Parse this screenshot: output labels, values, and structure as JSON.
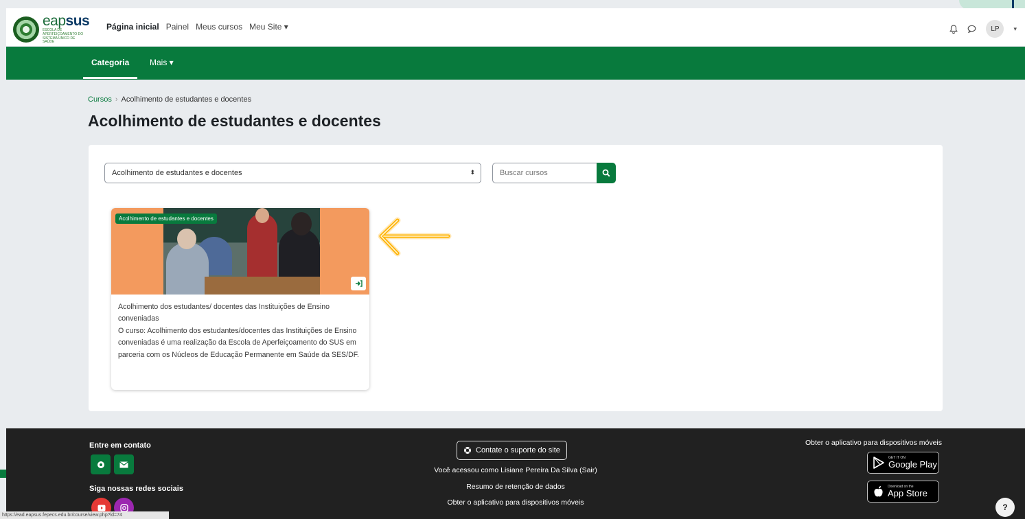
{
  "brand": {
    "name_light": "eap",
    "name_bold": "sus",
    "tagline": "ESCOLA DE APERFEIÇOAMENTO DO SISTEMA ÚNICO DE SAÚDE"
  },
  "nav": {
    "items": [
      {
        "label": "Página inicial"
      },
      {
        "label": "Painel"
      },
      {
        "label": "Meus cursos"
      },
      {
        "label": "Meu Site ▾"
      }
    ]
  },
  "user": {
    "initials": "LP"
  },
  "secondary_nav": {
    "category": "Categoria",
    "more": "Mais ▾"
  },
  "breadcrumb": {
    "root": "Cursos",
    "separator": "›",
    "current": "Acolhimento de estudantes e docentes"
  },
  "page_title": "Acolhimento de estudantes e docentes",
  "filters": {
    "category_value": "Acolhimento de estudantes e docentes",
    "search_placeholder": "Buscar cursos"
  },
  "course": {
    "badge": "Acolhimento de estudantes e docentes",
    "title": "Acolhimento dos estudantes/ docentes das Instituições de Ensino conveniadas",
    "summary": "O curso: Acolhimento dos estudantes/docentes das Instituições de Ensino conveniadas é uma realização da Escola de Aperfeiçoamento do SUS em parceria com os Núcleos de Educação Permanente em Saúde da SES/DF."
  },
  "footer": {
    "contact_title": "Entre em contato",
    "social_title": "Siga nossas redes sociais",
    "support_label": "Contate o suporte do site",
    "logged_in_text": "Você acessou como Lisiane Pereira Da Silva (Sair)",
    "data_retention": "Resumo de retenção de dados",
    "mobile_app_link": "Obter o aplicativo para dispositivos móveis",
    "mobile_app_title": "Obter o aplicativo para dispositivos móveis",
    "google_play_small": "GET IT ON",
    "google_play_big": "Google Play",
    "app_store_small": "Download on the",
    "app_store_big": "App Store",
    "help": "?"
  },
  "status_url": "https://ead.eapsus.fepecs.edu.br/course/view.php?id=74",
  "colors": {
    "primary": "#087a3d",
    "footer_bg": "#212121",
    "page_bg": "#e9ecef",
    "card_image_bg": "#f39a5e",
    "annotation_arrow": "#ffb300"
  },
  "icons": {
    "bell": "bell-icon",
    "chat": "chat-icon",
    "search": "search-icon",
    "enter": "enter-course-icon",
    "globe": "globe-icon",
    "mail": "mail-icon",
    "youtube": "youtube-icon",
    "instagram": "instagram-icon",
    "support": "lifebuoy-icon",
    "google_play": "play-triangle-icon",
    "apple": "apple-icon"
  }
}
